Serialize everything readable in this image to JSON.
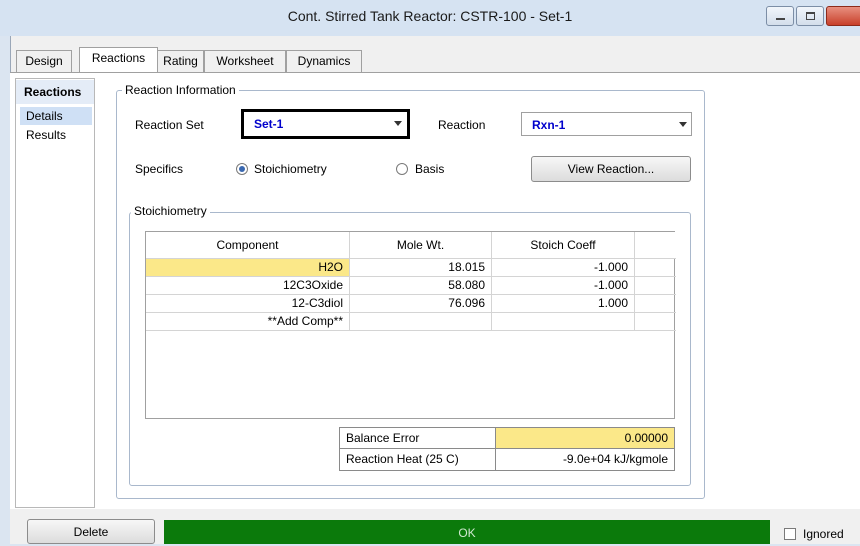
{
  "window": {
    "title": "Cont. Stirred Tank Reactor: CSTR-100 - Set-1"
  },
  "tabs": [
    {
      "label": "Design"
    },
    {
      "label": "Reactions",
      "active": true
    },
    {
      "label": "Rating"
    },
    {
      "label": "Worksheet"
    },
    {
      "label": "Dynamics"
    }
  ],
  "sidebar": {
    "header": "Reactions",
    "items": [
      {
        "label": "Details",
        "selected": true
      },
      {
        "label": "Results"
      }
    ]
  },
  "reaction_info": {
    "legend": "Reaction Information",
    "reaction_set_label": "Reaction Set",
    "reaction_set_value": "Set-1",
    "reaction_label": "Reaction",
    "reaction_value": "Rxn-1",
    "specifics_label": "Specifics",
    "radio_stoich": "Stoichiometry",
    "radio_basis": "Basis",
    "view_reaction_button": "View Reaction..."
  },
  "stoichiometry": {
    "legend": "Stoichiometry",
    "columns": [
      "Component",
      "Mole Wt.",
      "Stoich Coeff"
    ],
    "rows": [
      {
        "component": "H2O",
        "mole_wt": "18.015",
        "coeff": "-1.000"
      },
      {
        "component": "12C3Oxide",
        "mole_wt": "58.080",
        "coeff": "-1.000"
      },
      {
        "component": "12-C3diol",
        "mole_wt": "76.096",
        "coeff": "1.000"
      },
      {
        "component": "**Add Comp**",
        "mole_wt": "",
        "coeff": ""
      }
    ],
    "balance_error_label": "Balance Error",
    "balance_error_value": "0.00000",
    "reaction_heat_label": "Reaction Heat (25 C)",
    "reaction_heat_value": "-9.0e+04 kJ/kgmole"
  },
  "footer": {
    "delete_button": "Delete",
    "status": "OK",
    "ignored_label": "Ignored"
  },
  "colors": {
    "status_ok": "#0b7a0b",
    "highlight": "#fbe889",
    "link_value": "#0000cc"
  }
}
